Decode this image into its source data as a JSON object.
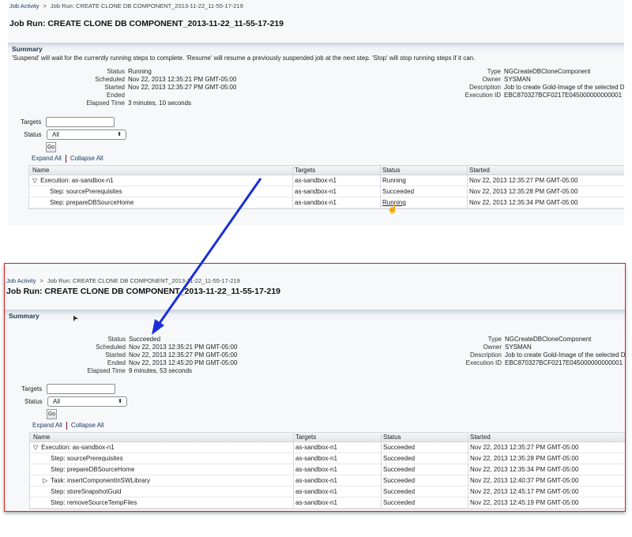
{
  "colors": {
    "arrow": "#1a2fd6",
    "frame": "#e02020"
  },
  "before": {
    "breadcrumb": {
      "root": "Job Activity",
      "sep": ">",
      "current": "Job Run: CREATE CLONE DB COMPONENT_2013-11-22_11-55-17-219"
    },
    "title": "Job Run: CREATE CLONE DB COMPONENT_2013-11-22_11-55-17-219",
    "summary_title": "Summary",
    "hint": "'Suspend' will wait for the currently running steps to complete. 'Resume' will resume a previously suspended job at the next step. 'Stop' will stop running steps if it can.",
    "left_fields": [
      {
        "label": "Status",
        "value": "Running"
      },
      {
        "label": "Scheduled",
        "value": "Nov 22, 2013 12:35:21 PM GMT-05:00"
      },
      {
        "label": "Started",
        "value": "Nov 22, 2013 12:35:27 PM GMT-05:00"
      },
      {
        "label": "Ended",
        "value": ""
      },
      {
        "label": "Elapsed Time",
        "value": "3 minutes, 10 seconds"
      }
    ],
    "right_fields": [
      {
        "label": "Type",
        "value": "NGCreateDBCloneComponent"
      },
      {
        "label": "Owner",
        "value": "SYSMAN"
      },
      {
        "label": "Description",
        "value": "Job to create Gold-Image of the selected Dat"
      },
      {
        "label": "Execution ID",
        "value": "EBC870327BCF0217E045000000000001"
      }
    ],
    "filters": {
      "targets_label": "Targets",
      "targets_value": "",
      "status_label": "Status",
      "status_value": "All",
      "go": "Go"
    },
    "expand_all": "Expand All",
    "collapse_all": "Collapse All",
    "columns": [
      "Name",
      "Targets",
      "Status",
      "Started"
    ],
    "rows": [
      {
        "toggle": "▽",
        "name": "Execution: as-sandbox-n1",
        "target": "as-sandbox-n1",
        "status": "Running",
        "started": "Nov 22, 2013 12:35:27 PM GMT-05:00"
      },
      {
        "name": "Step: sourcePrerequisites",
        "target": "as-sandbox-n1",
        "status": "Succeeded",
        "started": "Nov 22, 2013 12:35:28 PM GMT-05:00"
      },
      {
        "name": "Step: prepareDBSourceHome",
        "target": "as-sandbox-n1",
        "status": "Running",
        "started": "Nov 22, 2013 12:35:34 PM GMT-05:00"
      }
    ]
  },
  "after": {
    "breadcrumb": {
      "root": "Job Activity",
      "sep": ">",
      "current": "Job Run: CREATE CLONE DB COMPONENT_2013-11-22_11-55-17-219"
    },
    "title": "Job Run: CREATE CLONE DB COMPONENT_2013-11-22_11-55-17-219",
    "summary_title": "Summary",
    "left_fields": [
      {
        "label": "Status",
        "value": "Succeeded"
      },
      {
        "label": "Scheduled",
        "value": "Nov 22, 2013 12:35:21 PM GMT-05:00"
      },
      {
        "label": "Started",
        "value": "Nov 22, 2013 12:35:27 PM GMT-05:00"
      },
      {
        "label": "Ended",
        "value": "Nov 22, 2013 12:45:20 PM GMT-05:00"
      },
      {
        "label": "Elapsed Time",
        "value": "9 minutes, 53 seconds"
      }
    ],
    "right_fields": [
      {
        "label": "Type",
        "value": "NGCreateDBCloneComponent"
      },
      {
        "label": "Owner",
        "value": "SYSMAN"
      },
      {
        "label": "Description",
        "value": "Job to create Gold-Image of the selected Da"
      },
      {
        "label": "Execution ID",
        "value": "EBC870327BCF0217E045000000000001"
      }
    ],
    "filters": {
      "targets_label": "Targets",
      "targets_value": "",
      "status_label": "Status",
      "status_value": "All",
      "go": "Go"
    },
    "expand_all": "Expand All",
    "collapse_all": "Collapse All",
    "columns": [
      "Name",
      "Targets",
      "Status",
      "Started"
    ],
    "rows": [
      {
        "toggle": "▽",
        "name": "Execution: as-sandbox-n1",
        "target": "as-sandbox-n1",
        "status": "Succeeded",
        "started": "Nov 22, 2013 12:35:27 PM GMT-05:00"
      },
      {
        "name": "Step: sourcePrerequisites",
        "target": "as-sandbox-n1",
        "status": "Succeeded",
        "started": "Nov 22, 2013 12:35:28 PM GMT-05:00"
      },
      {
        "name": "Step: prepareDBSourceHome",
        "target": "as-sandbox-n1",
        "status": "Succeeded",
        "started": "Nov 22, 2013 12:35:34 PM GMT-05:00"
      },
      {
        "toggle": "▷",
        "name": "Task: insertComponentInSWLibrary",
        "target": "as-sandbox-n1",
        "status": "Succeeded",
        "started": "Nov 22, 2013 12:40:37 PM GMT-05:00"
      },
      {
        "name": "Step: storeSnapshotGuid",
        "target": "as-sandbox-n1",
        "status": "Succeeded",
        "started": "Nov 22, 2013 12:45:17 PM GMT-05:00"
      },
      {
        "name": "Step: removeSourceTempFiles",
        "target": "as-sandbox-n1",
        "status": "Succeeded",
        "started": "Nov 22, 2013 12:45:19 PM GMT-05:00"
      }
    ]
  }
}
